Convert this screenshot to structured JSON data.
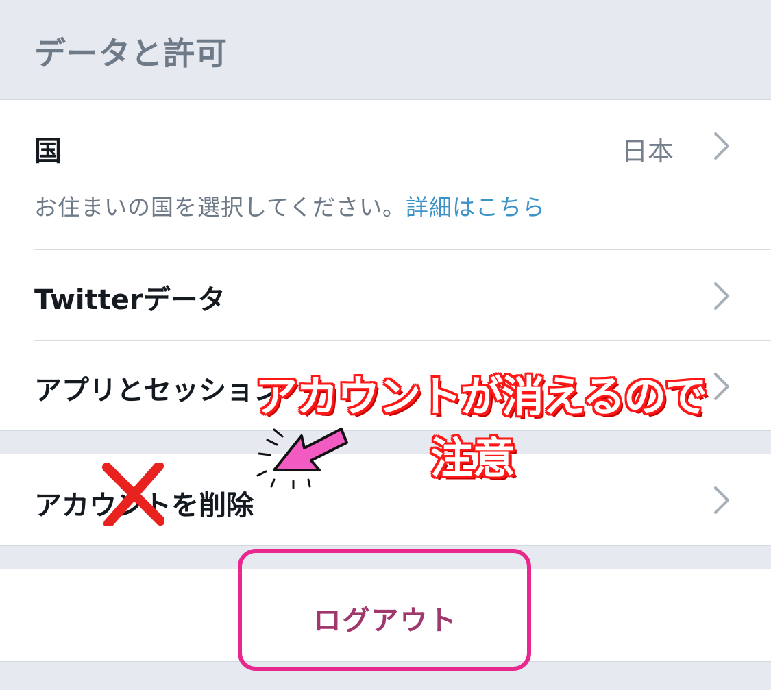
{
  "header": {
    "title": "データと許可"
  },
  "country": {
    "label": "国",
    "value": "日本",
    "description": "お住まいの国を選択してください。",
    "link": "詳細はこちら"
  },
  "rows": {
    "twitter_data": "Twitterデータ",
    "apps_sessions": "アプリとセッション",
    "delete_account": "アカウントを削除"
  },
  "logout": {
    "label": "ログアウト"
  },
  "annotation": {
    "line1": "アカウントが消えるので",
    "line2": "注意"
  },
  "colors": {
    "header_bg": "#e6e9f0",
    "link": "#3d93c8",
    "logout_text": "#a0386d",
    "highlight": "#e9288e",
    "cross_mark": "#e8231f",
    "arrow": "#f25bc1"
  },
  "icons": {
    "chevron": "chevron-right-icon",
    "cross": "cross-mark-icon",
    "arrow": "pointer-arrow-icon"
  }
}
